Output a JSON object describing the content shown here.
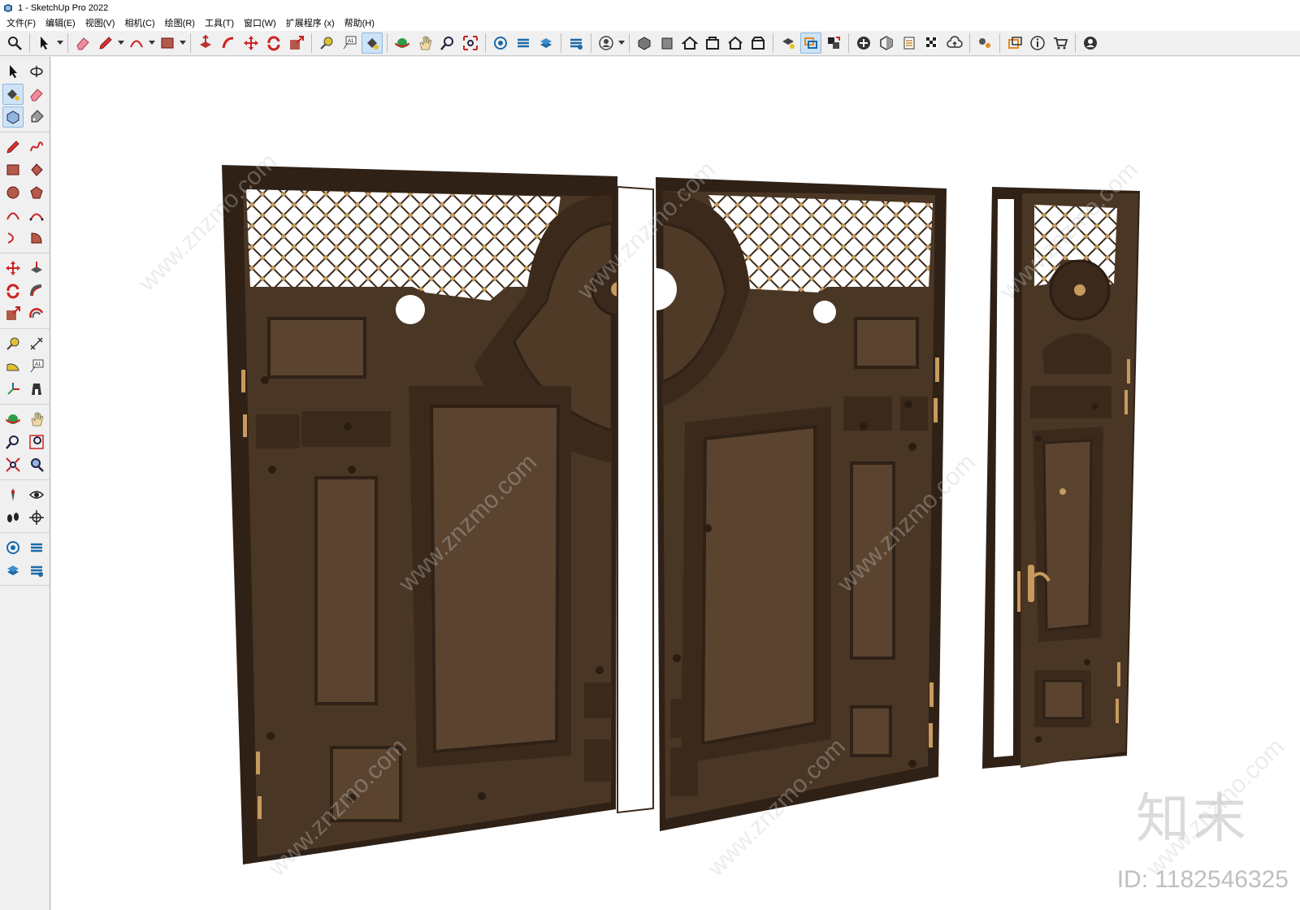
{
  "window": {
    "title": "1 - SketchUp Pro 2022"
  },
  "menu": [
    "文件(F)",
    "编辑(E)",
    "视图(V)",
    "相机(C)",
    "绘图(R)",
    "工具(T)",
    "窗口(W)",
    "扩展程序 (x)",
    "帮助(H)"
  ],
  "toolbar_icons": [
    "zoom-icon",
    "select-icon",
    "eraser-icon",
    "pencil-icon",
    "arc-icon",
    "rectangle-icon",
    "push-pull-icon",
    "follow-me-icon",
    "move-icon",
    "rotate-icon",
    "scale-icon",
    "tape-measure-icon",
    "text-icon",
    "paint-bucket-icon",
    "orbit-icon",
    "pan-icon",
    "zoom-window-icon",
    "zoom-extents-icon",
    "warehouse-icon",
    "share-model-icon",
    "extension-warehouse-icon",
    "layout-icon",
    "user-icon",
    "iso-view-icon",
    "front-view-icon",
    "home-view-icon",
    "top-view-icon",
    "back-view-icon",
    "section-view-icon",
    "materials-icon",
    "components-icon",
    "styles-icon",
    "add-location-icon",
    "shadow-icon",
    "fog-icon",
    "match-photo-icon",
    "cloud-icon",
    "extension-manager-icon",
    "presentation-icon",
    "info-icon",
    "cart-icon",
    "account-icon"
  ],
  "left_toolbar_icons": [
    [
      "select-icon",
      "orbit-icon"
    ],
    [
      "paint-bucket-icon",
      "eraser-icon"
    ],
    [
      "component-icon",
      "tag-icon"
    ],
    [
      "pencil-icon",
      "freehand-icon"
    ],
    [
      "rectangle-icon",
      "rotated-rectangle-icon"
    ],
    [
      "circle-icon",
      "polygon-icon"
    ],
    [
      "arc-icon",
      "two-point-arc-icon"
    ],
    [
      "three-point-arc-icon",
      "pie-icon"
    ],
    [
      "move-icon",
      "push-pull-icon"
    ],
    [
      "rotate-icon",
      "follow-me-icon"
    ],
    [
      "scale-icon",
      "offset-icon"
    ],
    [
      "tape-measure-icon",
      "dimension-icon"
    ],
    [
      "protractor-icon",
      "text-icon"
    ],
    [
      "axes-icon",
      "3d-text-icon"
    ],
    [
      "orbit-icon",
      "pan-icon"
    ],
    [
      "zoom-icon",
      "zoom-window-icon"
    ],
    [
      "zoom-extents-icon",
      "previous-view-icon"
    ],
    [
      "position-camera-icon",
      "look-around-icon"
    ],
    [
      "walk-icon",
      "section-plane-icon"
    ],
    [
      "3d-warehouse-icon",
      "extension-warehouse-icon"
    ],
    [
      "share-model-icon",
      "model-info-icon"
    ]
  ],
  "colors": {
    "door_wood_dark": "#3b2a1c",
    "door_wood_mid": "#4a3624",
    "door_wood_light": "#5a4430",
    "door_frame": "#2f2116",
    "brass": "#c79a5e",
    "lattice": "#3a2a1c",
    "viewport_bg": "#ffffff",
    "toolbar_bg": "#f0f0f0",
    "accent_active": "#cfe3f7"
  },
  "watermark": {
    "logo": "知末",
    "id": "ID: 1182546325",
    "site": "www.znzmo.com"
  }
}
